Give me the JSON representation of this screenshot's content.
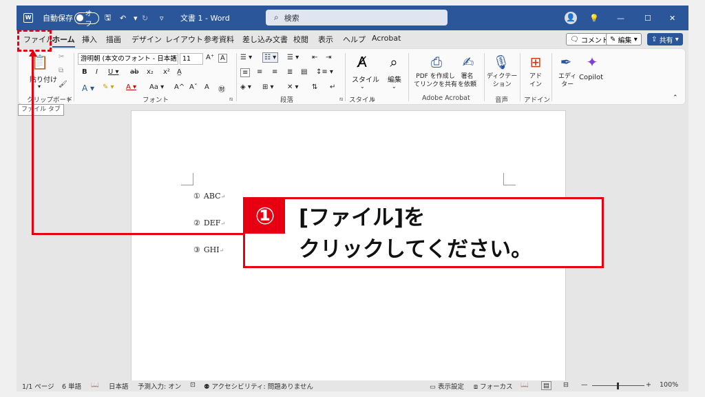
{
  "titlebar": {
    "autosave_label": "自動保存",
    "autosave_state": "オフ",
    "doc_title": "文書 1  -  Word",
    "search_placeholder": "検索"
  },
  "tabs": [
    "ファイル",
    "ホーム",
    "挿入",
    "描画",
    "デザイン",
    "レイアウト",
    "参考資料",
    "差し込み文書",
    "校閲",
    "表示",
    "ヘルプ",
    "Acrobat"
  ],
  "tab_buttons": {
    "comments": "コメント",
    "edit": "編集",
    "share": "共有"
  },
  "ribbon": {
    "clipboard": {
      "paste": "貼り付け",
      "label": "クリップボード"
    },
    "font": {
      "font_name": "游明朝 (本文のフォント - 日本語)",
      "font_size": "11",
      "label": "フォント",
      "case_label": "Aa"
    },
    "paragraph": {
      "label": "段落"
    },
    "styles": {
      "button": "スタイル",
      "label": "スタイル"
    },
    "editing": {
      "button": "編集"
    },
    "acrobat": {
      "create_share": "PDF を作成し\nてリンクを共有",
      "sign": "署名\nを依頼",
      "label": "Adobe Acrobat"
    },
    "voice": {
      "dictate": "ディクテー\nション",
      "label": "音声"
    },
    "addins": {
      "button": "アド\nイン",
      "label": "アドイン"
    },
    "editor": {
      "button": "エディ\nター"
    },
    "copilot": {
      "button": "Copilot"
    }
  },
  "tooltip": "ファイル タブ",
  "document": {
    "lines": [
      {
        "num": "①",
        "text": "ABC"
      },
      {
        "num": "②",
        "text": "DEF"
      },
      {
        "num": "③",
        "text": "GHI"
      }
    ]
  },
  "status": {
    "page": "1/1 ページ",
    "words": "6 単語",
    "language": "日本語",
    "predict": "予測入力: オン",
    "accessibility": "アクセシビリティ: 問題ありません",
    "display_settings": "表示設定",
    "focus": "フォーカス",
    "zoom": "100%"
  },
  "callout": {
    "number": "①",
    "line1": "[ファイル]を",
    "line2": "クリックしてください。"
  },
  "colors": {
    "word_blue": "#2b579a",
    "annotation_red": "#e60012"
  }
}
